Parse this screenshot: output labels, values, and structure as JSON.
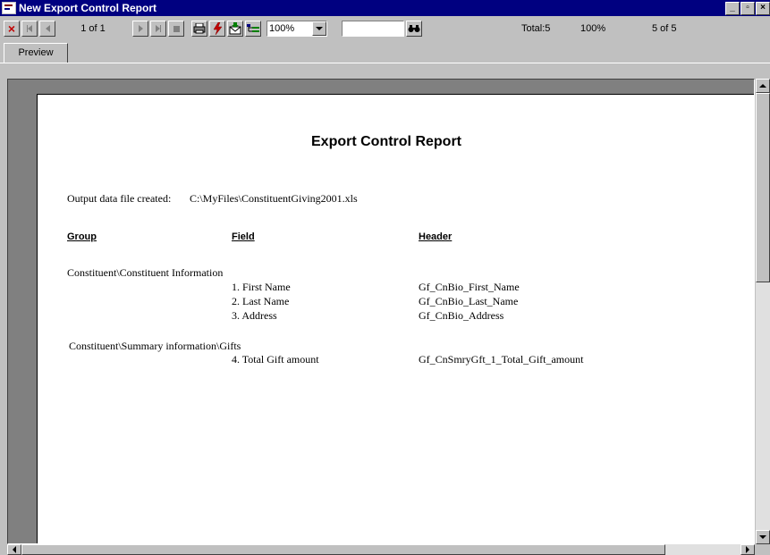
{
  "window": {
    "title": "New Export Control Report"
  },
  "toolbar": {
    "page_indicator": "1 of 1",
    "zoom": "100%",
    "search_value": "",
    "total_label": "Total:5",
    "percent_label": "100%",
    "record_label": "5 of 5"
  },
  "tabs": [
    {
      "label": "Preview"
    }
  ],
  "report": {
    "title": "Export Control Report",
    "output_label": "Output data file created:",
    "output_path": "C:\\MyFiles\\ConstituentGiving2001.xls",
    "columns": {
      "group": "Group",
      "field": "Field",
      "header": "Header"
    },
    "groups": [
      {
        "name": "Constituent\\Constituent Information",
        "rows": [
          {
            "field": "1. First Name",
            "header": "Gf_CnBio_First_Name"
          },
          {
            "field": "2. Last Name",
            "header": "Gf_CnBio_Last_Name"
          },
          {
            "field": "3. Address",
            "header": "Gf_CnBio_Address"
          }
        ]
      },
      {
        "name": "Constituent\\Summary information\\Gifts",
        "rows": [
          {
            "field": "4. Total Gift amount",
            "header": "Gf_CnSmryGft_1_Total_Gift_amount"
          }
        ]
      }
    ]
  }
}
